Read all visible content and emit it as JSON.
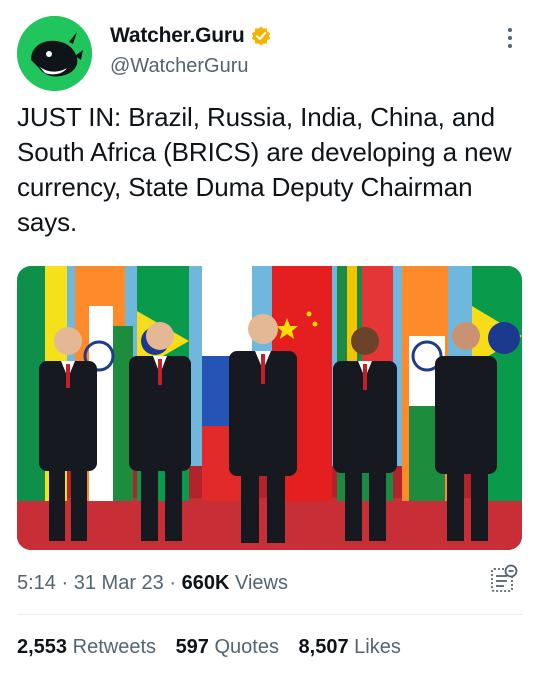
{
  "account": {
    "display_name": "Watcher.Guru",
    "handle": "@WatcherGuru",
    "avatar_color": "#21c55d",
    "verified_badge_color": "#f4b400"
  },
  "tweet": {
    "text": "JUST IN: Brazil, Russia, India, China, and South Africa (BRICS) are developing a new currency, State Duma Deputy Chairman says."
  },
  "media": {
    "icon": "photo-of-five-leaders-with-flags"
  },
  "meta": {
    "time": "5:14",
    "separator": "·",
    "date": "31 Mar 23",
    "views_count": "660K",
    "views_label": "Views"
  },
  "stats": {
    "retweets_count": "2,553",
    "retweets_label": "Retweets",
    "quotes_count": "597",
    "quotes_label": "Quotes",
    "likes_count": "8,507",
    "likes_label": "Likes"
  }
}
